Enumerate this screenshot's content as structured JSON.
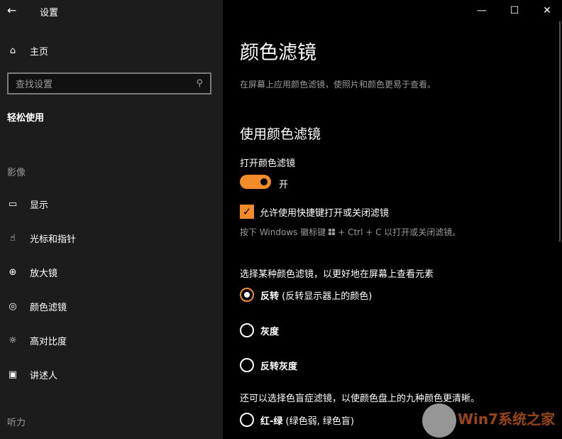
{
  "window": {
    "title": "设置",
    "minimize": "—",
    "maximize": "☐",
    "close": "✕"
  },
  "sidebar": {
    "home": "主页",
    "search_placeholder": "查找设置",
    "category": "轻松使用",
    "sections": [
      {
        "label": "影像"
      },
      {
        "label": "听力"
      }
    ],
    "items": [
      {
        "label": "显示",
        "icon": "monitor-icon",
        "glyph": "▭"
      },
      {
        "label": "光标和指针",
        "icon": "pointer-icon",
        "glyph": "☝"
      },
      {
        "label": "放大镜",
        "icon": "magnifier-icon",
        "glyph": "⊕"
      },
      {
        "label": "颜色滤镜",
        "icon": "palette-icon",
        "glyph": "◎"
      },
      {
        "label": "高对比度",
        "icon": "brightness-icon",
        "glyph": "☼"
      },
      {
        "label": "讲述人",
        "icon": "narrator-icon",
        "glyph": "▣"
      }
    ]
  },
  "main": {
    "title": "颜色滤镜",
    "description": "在屏幕上应用颜色滤镜，使照片和颜色更易于查看。",
    "section_title": "使用颜色滤镜",
    "toggle_label": "打开颜色滤镜",
    "toggle_state": "开",
    "toggle_on": true,
    "shortcut_checkbox": "允许使用快捷键打开或关闭滤镜",
    "shortcut_checked": true,
    "shortcut_hint_pre": "按下 Windows 徽标键",
    "shortcut_hint_post": "+ Ctrl + C 以打开或关闭滤镜。",
    "filter_prompt": "选择某种颜色滤镜，以更好地在屏幕上查看元素",
    "filters": [
      {
        "label": "反转",
        "note": "(反转显示器上的颜色)",
        "selected": true
      },
      {
        "label": "灰度",
        "note": "",
        "selected": false
      },
      {
        "label": "反转灰度",
        "note": "",
        "selected": false
      }
    ],
    "colorblind_prompt": "还可以选择色盲症滤镜，以使颜色盘上的九种颜色更清晰。",
    "colorblind": [
      {
        "label": "红-绿",
        "note": "(绿色弱, 绿色盲)",
        "selected": false
      }
    ]
  },
  "watermark": "Win7系统之家",
  "accent": "#f28c28"
}
